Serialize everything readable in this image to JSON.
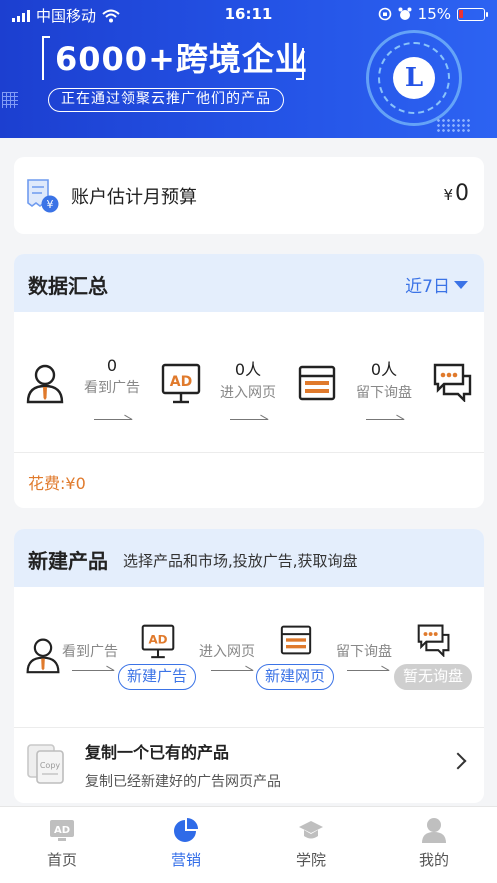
{
  "status_bar": {
    "carrier": "中国移动",
    "time": "16:11",
    "battery": "15%"
  },
  "banner": {
    "headline": "6000+跨境企业",
    "subline": "正在通过领聚云推广他们的产品",
    "logo_letter": "L"
  },
  "budget": {
    "label": "账户估计月预算",
    "currency": "¥",
    "amount": "0"
  },
  "summary": {
    "title": "数据汇总",
    "range": "近7日",
    "metrics": [
      {
        "value": "0",
        "label": "看到广告"
      },
      {
        "value": "0人",
        "label": "进入网页"
      },
      {
        "value": "0人",
        "label": "留下询盘"
      }
    ],
    "spend": "花费:¥0"
  },
  "product": {
    "title": "新建产品",
    "desc": "选择产品和市场,投放广告,获取询盘",
    "steps": [
      "看到广告",
      "进入网页",
      "留下询盘"
    ],
    "buttons": {
      "new_ad": "新建广告",
      "new_page": "新建网页",
      "no_inquiry": "暂无询盘"
    },
    "copy": {
      "title": "复制一个已有的产品",
      "desc": "复制已经新建好的广告网页产品"
    }
  },
  "tabs": [
    {
      "label": "首页",
      "icon": "ad-icon"
    },
    {
      "label": "营销",
      "icon": "pie-chart-icon"
    },
    {
      "label": "学院",
      "icon": "graduation-cap-icon"
    },
    {
      "label": "我的",
      "icon": "user-icon"
    }
  ],
  "colors": {
    "brand_blue": "#2453e6",
    "accent_orange": "#e07a2c",
    "tab_active": "#2f6be8"
  }
}
